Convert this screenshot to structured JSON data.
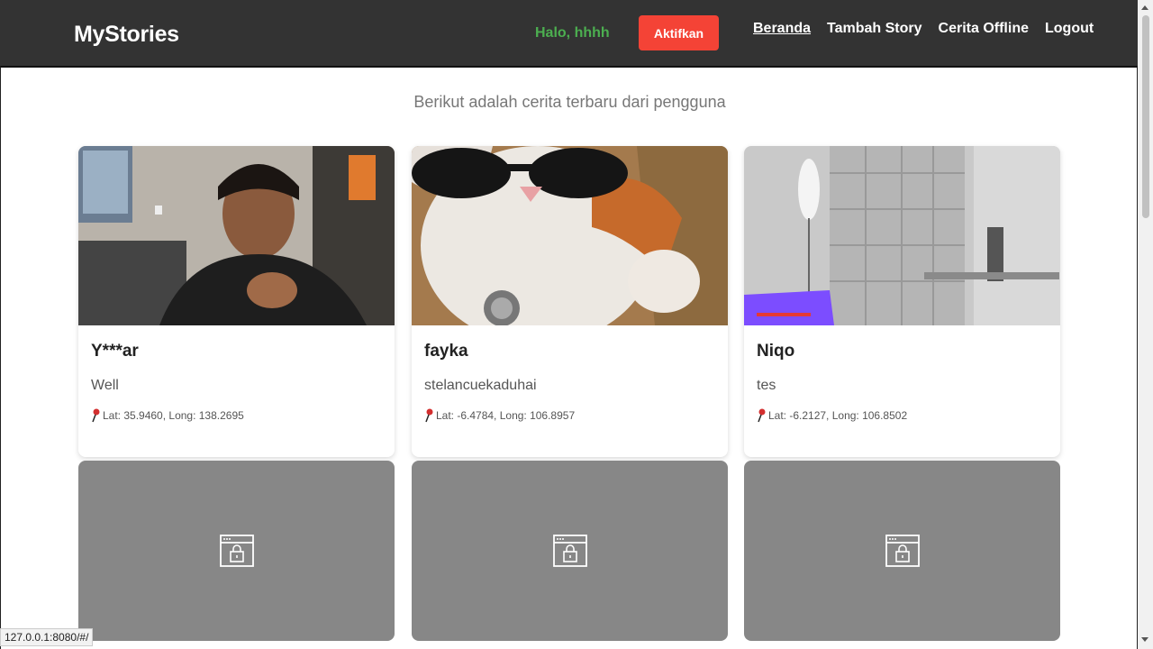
{
  "navbar": {
    "brand": "MyStories",
    "greeting": "Halo, hhhh",
    "activate_label": "Aktifkan",
    "links": [
      "Beranda",
      "Tambah Story",
      "Cerita Offline",
      "Logout"
    ]
  },
  "main": {
    "subtitle": "Berikut adalah cerita terbaru dari pengguna"
  },
  "stories": [
    {
      "name": "Y***ar",
      "description": "Well",
      "location": "Lat: 35.9460, Long: 138.2695"
    },
    {
      "name": "fayka",
      "description": "stelancuekaduhai",
      "location": "Lat: -6.4784, Long: 106.8957"
    },
    {
      "name": "Niqo",
      "description": "tes",
      "location": "Lat: -6.2127, Long: 106.8502"
    }
  ],
  "status_bar": {
    "url": "127.0.0.1:8080/#/"
  },
  "colors": {
    "navbar": "#333333",
    "greeting": "#4caf50",
    "activate": "#f44336",
    "locked_card": "#878787"
  }
}
